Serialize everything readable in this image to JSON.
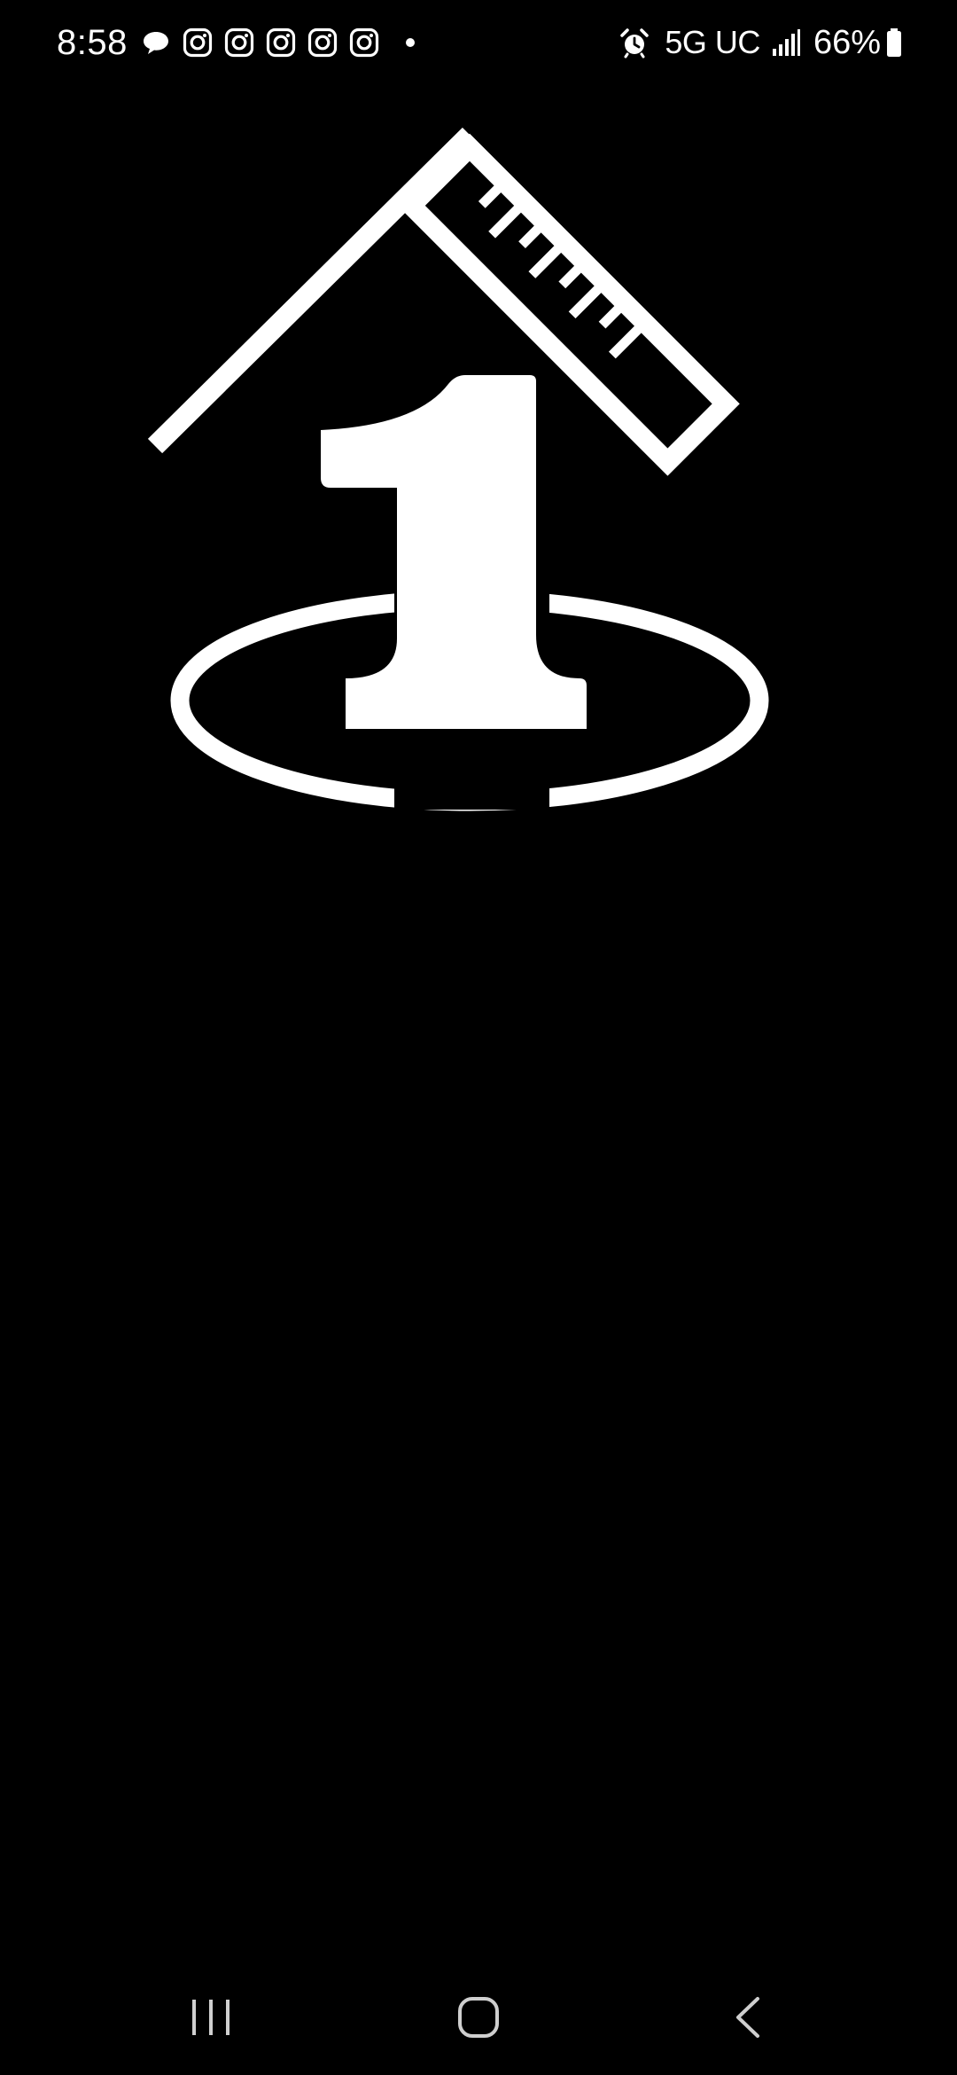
{
  "status_bar": {
    "time": "8:58",
    "notifications": [
      "chat-bubble-icon",
      "instagram-icon",
      "instagram-icon",
      "instagram-icon",
      "instagram-icon",
      "instagram-icon"
    ],
    "network": "5G UC",
    "battery": "66%"
  },
  "splash": {
    "logo_icon": "house-ruler-number-one-logo"
  },
  "nav_bar": {
    "buttons": [
      "recents-icon",
      "home-icon",
      "back-icon"
    ]
  },
  "colors": {
    "background": "#000000",
    "foreground": "#ffffff"
  }
}
